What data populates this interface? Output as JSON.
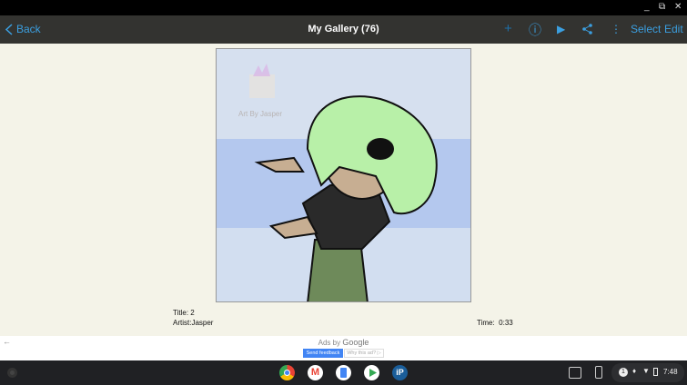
{
  "window": {
    "minimize": "_",
    "restore": "⧉",
    "close": "✕"
  },
  "appbar": {
    "back_label": "Back",
    "title": "My Gallery (76)",
    "add_icon": "+",
    "info_icon": "ⓘ",
    "play_icon": "▶",
    "share_icon": "share",
    "more_icon": "⋮",
    "select_label": "Select",
    "edit_label": "Edit"
  },
  "artwork": {
    "watermark": "Art By Jasper"
  },
  "details": {
    "title_label": "Title:",
    "title_value": "2",
    "artist_label": "Artist:",
    "artist_value": "Jasper",
    "time_label": "Time:",
    "time_value": "0:33"
  },
  "ad": {
    "ads_by": "Ads by",
    "google": "Google",
    "send_feedback": "Send feedback",
    "why_this_ad": "Why this ad? ▷"
  },
  "shelf": {
    "time": "7:48",
    "notification_count": "1"
  }
}
